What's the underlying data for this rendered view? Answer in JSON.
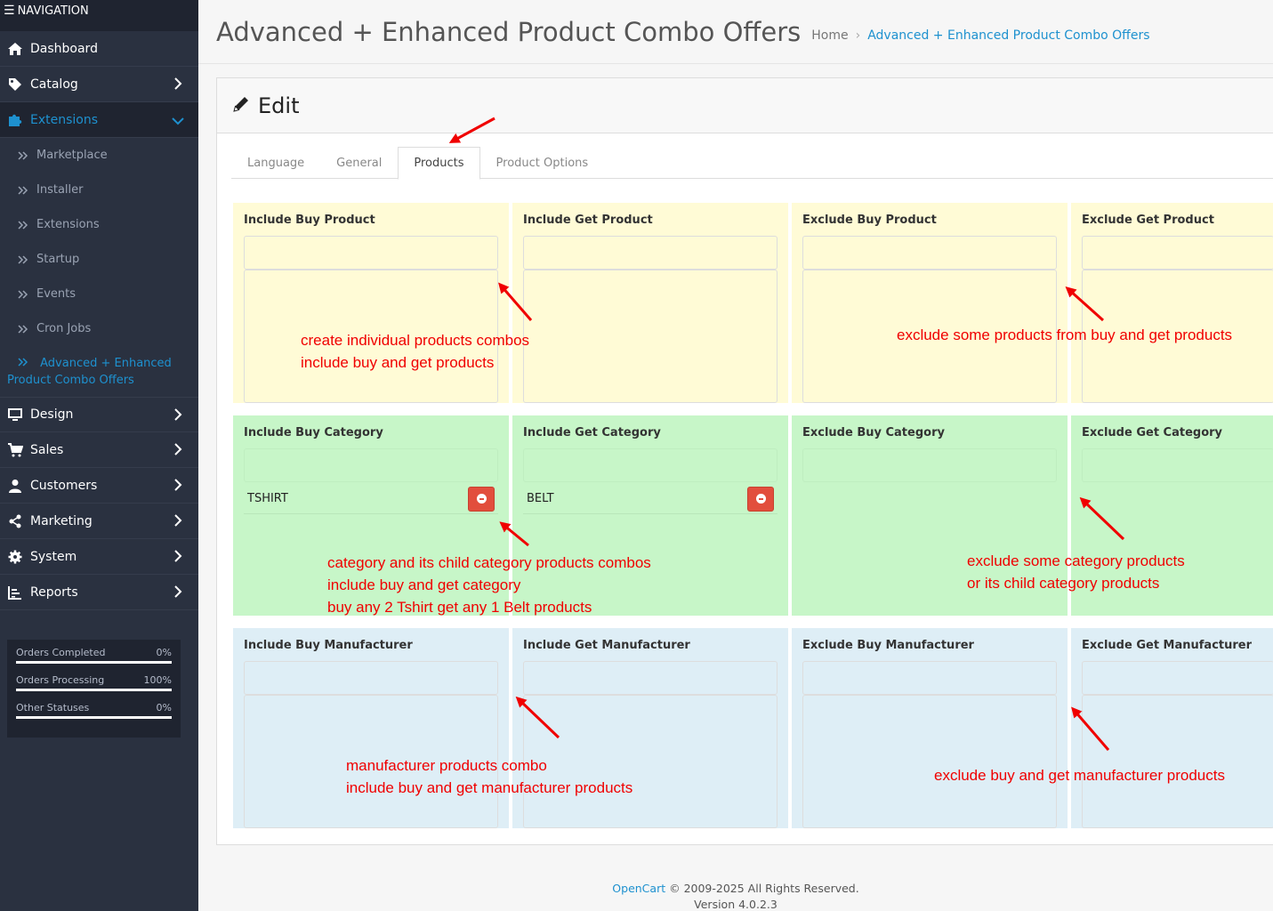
{
  "nav": {
    "header": "NAVIGATION",
    "items": [
      {
        "label": "Dashboard",
        "icon": "home-icon"
      },
      {
        "label": "Catalog",
        "icon": "tag-icon"
      },
      {
        "label": "Extensions",
        "icon": "puzzle-icon"
      },
      {
        "label": "Design",
        "icon": "monitor-icon"
      },
      {
        "label": "Sales",
        "icon": "cart-icon"
      },
      {
        "label": "Customers",
        "icon": "user-icon"
      },
      {
        "label": "Marketing",
        "icon": "share-icon"
      },
      {
        "label": "System",
        "icon": "gear-icon"
      },
      {
        "label": "Reports",
        "icon": "chart-icon"
      }
    ],
    "extensions_sub": [
      "Marketplace",
      "Installer",
      "Extensions",
      "Startup",
      "Events",
      "Cron Jobs",
      "Advanced + Enhanced Product Combo Offers"
    ]
  },
  "stats": [
    {
      "label": "Orders Completed",
      "value": "0%",
      "fraction": 0
    },
    {
      "label": "Orders Processing",
      "value": "100%",
      "fraction": 1
    },
    {
      "label": "Other Statuses",
      "value": "0%",
      "fraction": 0
    }
  ],
  "header": {
    "title": "Advanced + Enhanced Product Combo Offers",
    "breadcrumb_home": "Home",
    "breadcrumb_current": "Advanced + Enhanced Product Combo Offers"
  },
  "card": {
    "title": "Edit"
  },
  "tabs": [
    "Language",
    "General",
    "Products",
    "Product Options"
  ],
  "panels": {
    "products": [
      "Include Buy Product",
      "Include Get Product",
      "Exclude Buy Product",
      "Exclude Get Product"
    ],
    "categories": [
      "Include Buy Category",
      "Include Get Category",
      "Exclude Buy Category",
      "Exclude Get Category"
    ],
    "manufacturers": [
      "Include Buy Manufacturer",
      "Include Get Manufacturer",
      "Exclude Buy Manufacturer",
      "Exclude Get Manufacturer"
    ]
  },
  "selected_categories": {
    "buy": "TSHIRT",
    "get": "BELT"
  },
  "notes": {
    "products_include": [
      "create individual products combos",
      "include buy and get products"
    ],
    "products_exclude": [
      "exclude some products from buy and get products"
    ],
    "category_include": [
      "category and its child category products combos",
      "include buy and get category",
      "buy any 2 Tshirt get any 1 Belt products"
    ],
    "category_exclude": [
      "exclude some category products",
      "or its child category products"
    ],
    "manufacturer_include": [
      "manufacturer products combo",
      "include buy and get manufacturer products"
    ],
    "manufacturer_exclude": [
      "exclude buy and get manufacturer products"
    ]
  },
  "footer": {
    "brand": "OpenCart",
    "copyright": " © 2009-2025 All Rights Reserved.",
    "version": "Version 4.0.2.3"
  },
  "colors": {
    "accent": "#1e91cf",
    "annotation": "#f00000",
    "remove_button": "#e24e3d"
  }
}
